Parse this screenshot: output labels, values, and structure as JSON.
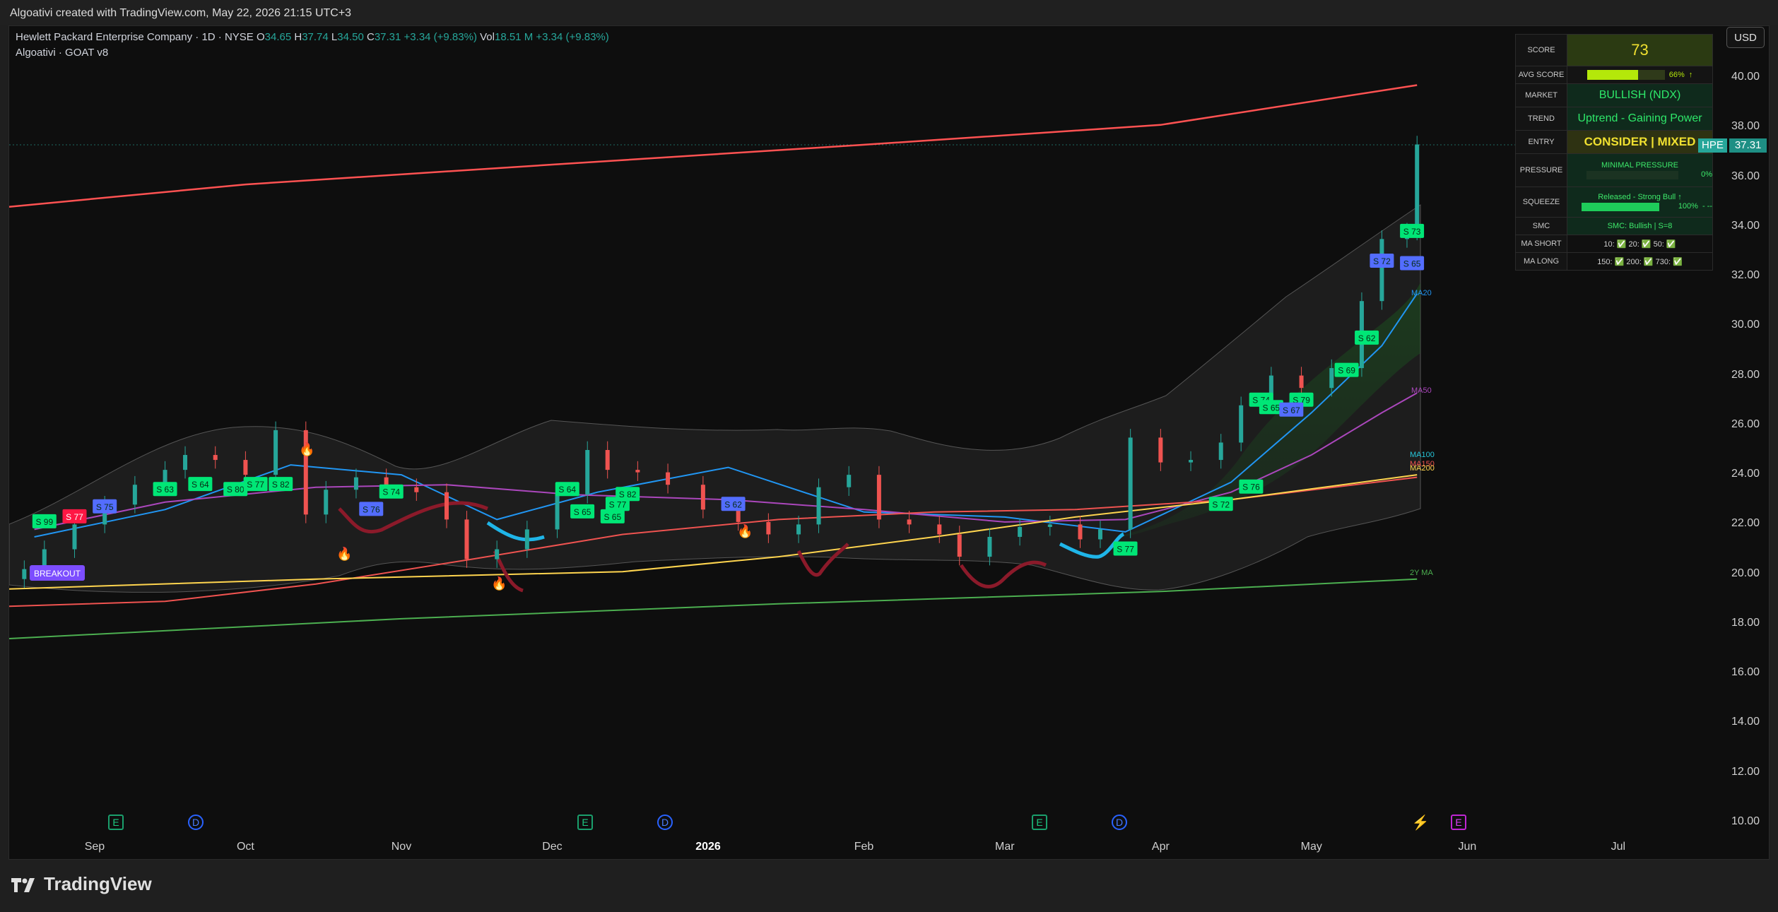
{
  "header": {
    "title": "Algoativi created with TradingView.com, May 22, 2026 21:15 UTC+3"
  },
  "legend": {
    "symbol": "Hewlett Packard Enterprise Company · 1D · NYSE",
    "o_label": "O",
    "o": "34.65",
    "h_label": "H",
    "h": "37.74",
    "l_label": "L",
    "l": "34.50",
    "c_label": "C",
    "c": "37.31",
    "change": "+3.34 (+9.83%)",
    "vol_label": "Vol",
    "vol": "18.51 M",
    "vol_change": "+3.34 (+9.83%)",
    "indicator": "Algoativi · GOAT v8"
  },
  "currency": "USD",
  "price_tag": {
    "symbol": "HPE",
    "price": "37.31"
  },
  "score_panel": {
    "score_label": "SCORE",
    "score": "73",
    "avg_label": "AVG SCORE",
    "avg_pct": "66%",
    "avg_arrow": "↑",
    "avg_fraction": 0.66,
    "market_label": "MARKET",
    "market": "BULLISH (NDX)",
    "trend_label": "TREND",
    "trend": "Uptrend - Gaining Power",
    "entry_label": "ENTRY",
    "entry": "CONSIDER | MIXED",
    "pressure_label": "PRESSURE",
    "pressure": "MINIMAL PRESSURE",
    "pressure_pct": "0%",
    "pressure_fraction": 0.0,
    "squeeze_label": "SQUEEZE",
    "squeeze": "Released - Strong Bull ↑",
    "squeeze_pct": "100%",
    "squeeze_extra": "- --",
    "squeeze_fraction": 1.0,
    "smc_label": "SMC",
    "smc": "SMC: Bullish | S=8",
    "ma_short_label": "MA SHORT",
    "ma_short": "10: ✅ 20: ✅ 50: ✅",
    "ma_long_label": "MA LONG",
    "ma_long": "150: ✅ 200: ✅ 730: ✅"
  },
  "y_axis": [
    "40.00",
    "38.00",
    "36.00",
    "34.00",
    "32.00",
    "30.00",
    "28.00",
    "26.00",
    "24.00",
    "22.00",
    "20.00",
    "18.00",
    "16.00",
    "14.00",
    "12.00",
    "10.00"
  ],
  "x_axis": [
    "Sep",
    "Oct",
    "Nov",
    "Dec",
    "2026",
    "Feb",
    "Mar",
    "Apr",
    "May",
    "Jun",
    "Jul"
  ],
  "events": [
    {
      "type": "E",
      "label": "E"
    },
    {
      "type": "D",
      "label": "D"
    },
    {
      "type": "E",
      "label": "E"
    },
    {
      "type": "D",
      "label": "D"
    },
    {
      "type": "E",
      "label": "E"
    },
    {
      "type": "D",
      "label": "D"
    },
    {
      "type": "bolt",
      "label": "⚡"
    },
    {
      "type": "E2",
      "label": "E"
    }
  ],
  "ma_labels": {
    "ma20": "MA20",
    "ma50": "MA50",
    "ma100": "MA100",
    "ma150": "MA150",
    "ma200": "MA200",
    "ma2y": "2Y MA"
  },
  "breakout_label": "BREAKOUT",
  "brand": "TradingView",
  "chart_data": {
    "type": "candlestick",
    "title": "Hewlett Packard Enterprise Company · 1D · NYSE",
    "ylim": [
      10,
      40
    ],
    "x_range": [
      "2025-08-15",
      "2026-07-20"
    ],
    "grid": false,
    "series": [
      {
        "name": "MA20",
        "color": "#2196f3",
        "x": [
          "2025-08-20",
          "2025-09-15",
          "2025-10-10",
          "2025-11-01",
          "2025-11-20",
          "2025-12-10",
          "2026-01-05",
          "2026-02-01",
          "2026-03-01",
          "2026-03-25",
          "2026-04-15",
          "2026-05-01",
          "2026-05-15",
          "2026-05-22"
        ],
        "y": [
          21.5,
          22.6,
          24.4,
          24.0,
          22.2,
          23.3,
          24.3,
          22.5,
          22.3,
          21.7,
          23.7,
          26.5,
          29.2,
          31.3
        ]
      },
      {
        "name": "MA50",
        "color": "#ab47bc",
        "x": [
          "2025-08-20",
          "2025-09-15",
          "2025-10-15",
          "2025-11-10",
          "2025-12-05",
          "2026-01-05",
          "2026-02-01",
          "2026-03-01",
          "2026-03-25",
          "2026-04-15",
          "2026-05-01",
          "2026-05-15",
          "2026-05-22"
        ],
        "y": [
          21.8,
          22.9,
          23.5,
          23.6,
          23.2,
          23.0,
          22.6,
          22.1,
          22.2,
          23.3,
          24.8,
          26.5,
          27.3
        ]
      },
      {
        "name": "MA150",
        "color": "#ef5350",
        "x": [
          "2025-08-15",
          "2025-09-15",
          "2025-10-15",
          "2025-11-15",
          "2025-12-15",
          "2026-01-15",
          "2026-02-15",
          "2026-03-15",
          "2026-04-15",
          "2026-05-22"
        ],
        "y": [
          18.7,
          18.9,
          19.6,
          20.6,
          21.6,
          22.2,
          22.5,
          22.6,
          23.0,
          23.9
        ]
      },
      {
        "name": "MA200",
        "color": "#ffd54f",
        "x": [
          "2025-08-15",
          "2025-10-15",
          "2025-12-15",
          "2026-01-15",
          "2026-02-15",
          "2026-03-15",
          "2026-04-15",
          "2026-05-22"
        ],
        "y": [
          19.4,
          19.8,
          20.1,
          20.7,
          21.5,
          22.3,
          23.0,
          24.0
        ]
      },
      {
        "name": "2Y MA",
        "color": "#4caf50",
        "x": [
          "2025-08-15",
          "2025-11-01",
          "2026-01-15",
          "2026-04-01",
          "2026-05-22"
        ],
        "y": [
          17.4,
          18.2,
          18.8,
          19.3,
          19.8
        ]
      },
      {
        "name": "Upper",
        "color": "#ff5252",
        "x": [
          "2025-08-15",
          "2025-10-01",
          "2025-12-01",
          "2026-02-01",
          "2026-04-01",
          "2026-05-22"
        ],
        "y": [
          34.8,
          35.7,
          36.5,
          37.3,
          38.1,
          39.7
        ]
      }
    ],
    "candles": {
      "x": [
        "2025-08-18",
        "2025-08-22",
        "2025-08-28",
        "2025-09-03",
        "2025-09-09",
        "2025-09-15",
        "2025-09-19",
        "2025-09-25",
        "2025-10-01",
        "2025-10-07",
        "2025-10-13",
        "2025-10-17",
        "2025-10-23",
        "2025-10-29",
        "2025-11-04",
        "2025-11-10",
        "2025-11-14",
        "2025-11-20",
        "2025-11-26",
        "2025-12-02",
        "2025-12-08",
        "2025-12-12",
        "2025-12-18",
        "2025-12-24",
        "2025-12-31",
        "2026-01-07",
        "2026-01-13",
        "2026-01-19",
        "2026-01-23",
        "2026-01-29",
        "2026-02-04",
        "2026-02-10",
        "2026-02-16",
        "2026-02-20",
        "2026-02-26",
        "2026-03-04",
        "2026-03-10",
        "2026-03-16",
        "2026-03-20",
        "2026-03-26",
        "2026-04-01",
        "2026-04-07",
        "2026-04-13",
        "2026-04-17",
        "2026-04-23",
        "2026-04-29",
        "2026-05-05",
        "2026-05-11",
        "2026-05-15",
        "2026-05-20",
        "2026-05-22"
      ],
      "close": [
        20.2,
        21.0,
        22.0,
        22.8,
        23.6,
        24.2,
        24.8,
        24.6,
        24.0,
        25.8,
        22.4,
        23.4,
        23.9,
        23.5,
        23.3,
        22.2,
        20.6,
        21.0,
        21.8,
        23.2,
        25.0,
        24.2,
        24.1,
        23.6,
        22.6,
        22.1,
        21.6,
        22.0,
        23.5,
        24.0,
        22.2,
        22.0,
        21.6,
        20.7,
        21.5,
        21.9,
        22.0,
        21.4,
        21.8,
        25.5,
        24.5,
        24.6,
        25.3,
        26.8,
        28.0,
        27.5,
        28.3,
        31.0,
        33.5,
        33.8,
        37.31
      ]
    }
  }
}
